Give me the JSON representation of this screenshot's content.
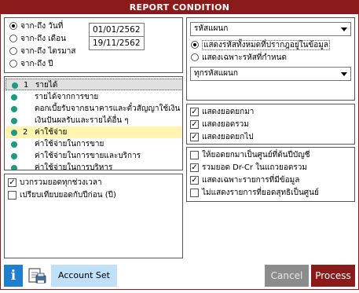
{
  "window": {
    "title": "REPORT CONDITION"
  },
  "period": {
    "options": [
      "จาก-ถึง วันที่",
      "จาก-ถึง เดือน",
      "จาก-ถึง ไตรมาส",
      "จาก-ถึง ปี"
    ],
    "selected_index": 0,
    "date_from": "01/01/2562",
    "date_to": "19/11/2562"
  },
  "accounts": {
    "items": [
      {
        "num": "1",
        "label": "รายได้"
      },
      {
        "num": "",
        "label": "รายได้จากการขาย"
      },
      {
        "num": "",
        "label": "ดอกเบี้ยรับจากธนาคารและตั๋วสัญญาใช้เงิน"
      },
      {
        "num": "",
        "label": "เงินปันผลรับและรายได้อื่น ๆ"
      },
      {
        "num": "2",
        "label": "ค่าใช้จ่าย"
      },
      {
        "num": "",
        "label": "ค่าใช้จ่ายในการขาย"
      },
      {
        "num": "",
        "label": "ค่าใช้จ่ายในการขายและบริการ"
      },
      {
        "num": "",
        "label": "ค่าใช้จ่ายในการบริหาร"
      }
    ]
  },
  "compare": {
    "options": [
      {
        "label": "บวกรวมยอดทุกช่วงเวลา",
        "checked": true
      },
      {
        "label": "เปรียบเทียบยอดกับปีก่อน (ปี)",
        "checked": false
      }
    ]
  },
  "department": {
    "select_label": "รหัสแผนก",
    "options": [
      "แสดงรหัสทั้งหมดที่ปรากฎอยู่ในข้อมูล",
      "แสดงเฉพาะรหัสที่กำหนด"
    ],
    "selected_index": 0,
    "filter_label": "ทุกรหัสแผนก"
  },
  "balances": {
    "options": [
      {
        "label": "แสดงยอดยกมา",
        "checked": true
      },
      {
        "label": "แสดงยอดรวม",
        "checked": true
      },
      {
        "label": "แสดงยอดยกไป",
        "checked": true
      }
    ]
  },
  "display": {
    "options": [
      {
        "label": "ให้ยอดยกมาเป็นศูนย์ที่ต้นปีบัญชี",
        "checked": false
      },
      {
        "label": "รวมยอด Dr-Cr ในแถวยอดรวม",
        "checked": true
      },
      {
        "label": "แสดงเฉพาะรายการที่มีข้อมูล",
        "checked": true
      },
      {
        "label": "ไม่แสดงรายการที่ยอดสุทธิเป็นศูนย์",
        "checked": false
      }
    ]
  },
  "buttons": {
    "account_set": "Account Set",
    "cancel": "Cancel",
    "process": "Process"
  },
  "colors": {
    "title_bar": "#8b1a1a",
    "info_button": "#1e7fd1",
    "account_set_button": "#bfe0f7",
    "process_button": "#8b1a1a",
    "cancel_button": "#8c8c8c",
    "selected_row": "#fff5b0",
    "bullet": "#1f9a80"
  }
}
